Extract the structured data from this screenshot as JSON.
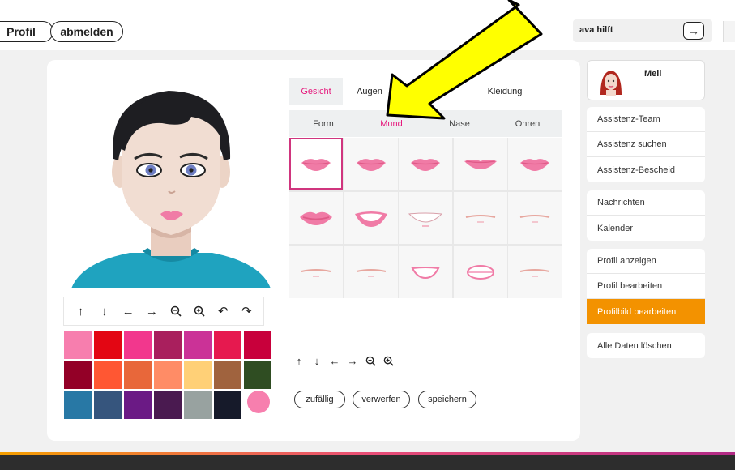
{
  "header": {
    "profile_button": "Profil",
    "logout_button": "abmelden",
    "help_label": "ava hilft",
    "help_go_icon": "→"
  },
  "editor": {
    "tabs": [
      {
        "label": "Gesicht",
        "active": true
      },
      {
        "label": "Augen",
        "active": false
      },
      {
        "label": "",
        "active": false
      },
      {
        "label": "Kleidung",
        "active": false
      }
    ],
    "subtabs": [
      {
        "label": "Form",
        "active": false
      },
      {
        "label": "Mund",
        "active": true
      },
      {
        "label": "Nase",
        "active": false
      },
      {
        "label": "Ohren",
        "active": false
      }
    ],
    "mouth_options": 15,
    "selected_mouth": 0,
    "left_toolbar_icons": [
      "arrow-up-icon",
      "arrow-down-icon",
      "arrow-left-icon",
      "arrow-right-icon",
      "zoom-out-icon",
      "zoom-in-icon",
      "undo-icon",
      "redo-icon"
    ],
    "right_toolbar_icons": [
      "arrow-up-icon",
      "arrow-down-icon",
      "arrow-left-icon",
      "arrow-right-icon",
      "zoom-out-icon",
      "zoom-in-icon"
    ],
    "actions": {
      "random": "zufällig",
      "discard": "verwerfen",
      "save": "speichern"
    },
    "palette": [
      "#f77eae",
      "#e30613",
      "#f2378d",
      "#a91f5d",
      "#cb3297",
      "#e6194f",
      "#c8003b",
      "#930027",
      "#ff5733",
      "#e8673a",
      "#ff8c66",
      "#ffd077",
      "#a0633e",
      "#2f4d22",
      "#2878a5",
      "#36557d",
      "#6b1a85",
      "#4a1a50",
      "#98a2a0",
      "#161a2a"
    ],
    "palette_circle": "#f77fae"
  },
  "sidebar": {
    "user_name": "Meli",
    "groups": [
      [
        "Assistenz-Team",
        "Assistenz suchen",
        "Assistenz-Bescheid"
      ],
      [
        "Nachrichten",
        "Kalender"
      ],
      [
        "Profil anzeigen",
        "Profil bearbeiten",
        "Profilbild bearbeiten"
      ],
      [
        "Alle Daten löschen"
      ]
    ],
    "active_item": "Profilbild bearbeiten",
    "accent": "#f39200"
  },
  "colors": {
    "accent_pink": "#e6187c",
    "annotation_yellow": "#ffff00"
  }
}
